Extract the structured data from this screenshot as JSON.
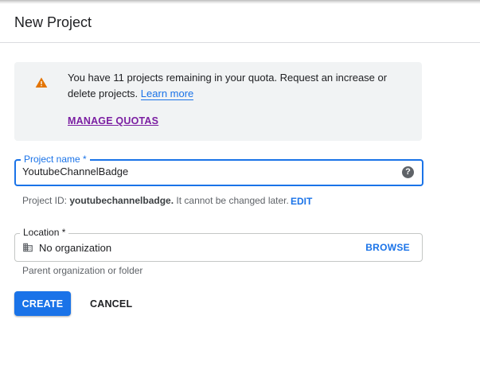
{
  "header": {
    "title": "New Project"
  },
  "notice": {
    "message": "You have 11 projects remaining in your quota. Request an increase or delete projects.",
    "learn_more": "Learn more",
    "manage_quotas": "MANAGE QUOTAS",
    "icon": "warning-icon",
    "icon_color": "#e37400"
  },
  "project_name": {
    "label": "Project name *",
    "value": "YoutubeChannelBadge",
    "help_icon": "help-icon"
  },
  "project_id": {
    "prefix": "Project ID:",
    "value": "youtubechannelbadge.",
    "suffix": "It cannot be changed later.",
    "edit": "EDIT"
  },
  "location": {
    "label": "Location *",
    "value": "No organization",
    "icon": "building-icon",
    "browse": "BROWSE",
    "hint": "Parent organization or folder"
  },
  "actions": {
    "create": "CREATE",
    "cancel": "CANCEL"
  },
  "colors": {
    "accent": "#1a73e8",
    "manage_link": "#7b1fa2",
    "notice_bg": "#f1f3f4"
  }
}
